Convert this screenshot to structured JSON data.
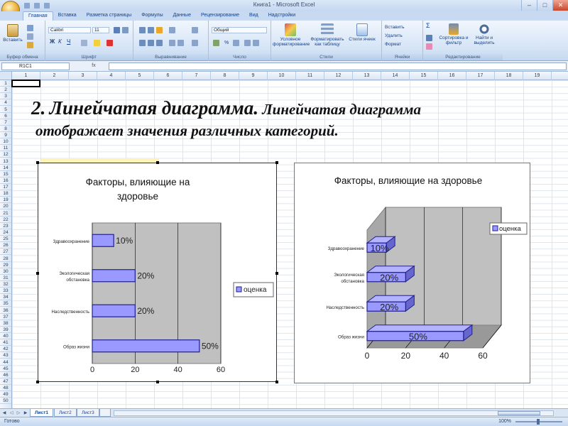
{
  "window": {
    "title": "Книга1 - Microsoft Excel"
  },
  "tabs": [
    "Главная",
    "Вставка",
    "Разметка страницы",
    "Формулы",
    "Данные",
    "Рецензирование",
    "Вид",
    "Надстройки"
  ],
  "ribbon": {
    "clipboard": {
      "paste": "Вставить",
      "label": "Буфер обмена"
    },
    "font": {
      "name": "Calibri",
      "size": "11",
      "label": "Шрифт"
    },
    "alignment": {
      "label": "Выравнивание"
    },
    "number": {
      "format": "Общий",
      "label": "Число"
    },
    "styles": {
      "conditional": "Условное форматирование",
      "table": "Форматировать как таблицу",
      "cell_styles": "Стили ячеек",
      "label": "Стили"
    },
    "cells": {
      "insert": "Вставить",
      "delete": "Удалить",
      "format": "Формат",
      "label": "Ячейки"
    },
    "editing": {
      "sort": "Сортировка и фильтр",
      "find": "Найти и выделить",
      "label": "Редактирование"
    }
  },
  "formula_bar": {
    "name_box": "R1C1",
    "fx": "fx",
    "value": ""
  },
  "columns": [
    "1",
    "2",
    "3",
    "4",
    "5",
    "6",
    "7",
    "8",
    "9",
    "10",
    "11",
    "12",
    "13",
    "14",
    "15",
    "16",
    "17",
    "18",
    "19"
  ],
  "rows": [
    "1",
    "2",
    "3",
    "4",
    "5",
    "6",
    "7",
    "8",
    "9",
    "10",
    "11",
    "12",
    "13",
    "14",
    "15",
    "16",
    "17",
    "18",
    "19",
    "20",
    "21",
    "22",
    "23",
    "24",
    "25",
    "26",
    "27",
    "28",
    "29",
    "30",
    "31",
    "32",
    "33",
    "34",
    "35",
    "36",
    "37",
    "38",
    "39",
    "40",
    "41",
    "42",
    "43",
    "44",
    "45",
    "46",
    "47",
    "48",
    "49",
    "50"
  ],
  "slide": {
    "number": "2.",
    "heading_bold": "Линейчатая диаграмма.",
    "heading_rest": "Линейчатая диаграмма",
    "line2": "отображает значения различных категорий."
  },
  "chart_data": [
    {
      "type": "bar",
      "orientation": "horizontal",
      "title": "Факторы, влияющие на здоровье",
      "categories": [
        "Здравоохранение",
        "Экологическая обстановка",
        "Наследственность",
        "Образ жизни"
      ],
      "series": [
        {
          "name": "оценка",
          "values": [
            10,
            20,
            20,
            50
          ],
          "labels": [
            "10%",
            "20%",
            "20%",
            "50%"
          ]
        }
      ],
      "xlim": [
        0,
        60
      ],
      "ticks": [
        "0",
        "20",
        "40",
        "60"
      ],
      "grid": true,
      "legend": "right"
    },
    {
      "type": "bar",
      "orientation": "horizontal",
      "style": "3d",
      "title": "Факторы, влияющие на здоровье",
      "categories": [
        "Здравоохранение",
        "Экологическая обстановка",
        "Наследственность",
        "Образ жизни"
      ],
      "series": [
        {
          "name": "оценка",
          "values": [
            10,
            20,
            20,
            50
          ],
          "labels": [
            "10%",
            "20%",
            "20%",
            "50%"
          ]
        }
      ],
      "xlim": [
        0,
        60
      ],
      "ticks": [
        "0",
        "20",
        "40",
        "60"
      ],
      "grid": true,
      "legend": "top-right"
    }
  ],
  "sheets": [
    "Лист1",
    "Лист2",
    "Лист3"
  ],
  "status": {
    "ready": "Готово",
    "zoom": "100%"
  },
  "colors": {
    "bar_fill": "#9999ff",
    "bar_stroke": "#1f1f8f",
    "plot_bg": "#c0c0c0",
    "ribbon_bg": "#d5e4f6"
  }
}
